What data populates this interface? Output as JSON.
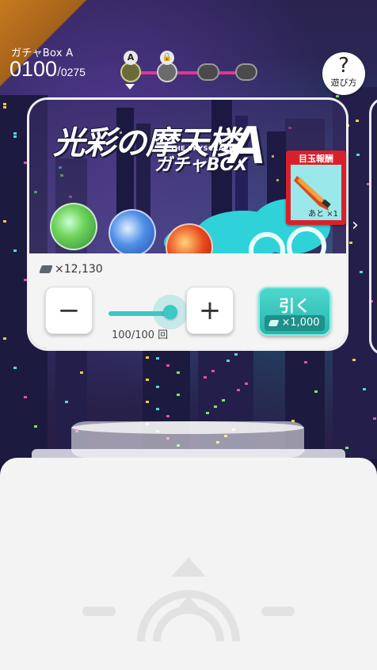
{
  "header": {
    "box_label": "ガチャBox A",
    "count_current": "0100",
    "count_separator": "/",
    "count_total": "0275"
  },
  "progress": {
    "nodes": [
      {
        "badge": "A",
        "state": "current"
      },
      {
        "badge": "lock",
        "state": "locked"
      },
      {
        "badge": "",
        "state": "empty"
      },
      {
        "badge": "",
        "state": "empty"
      }
    ]
  },
  "help": {
    "icon_text": "?",
    "label": "遊び方"
  },
  "gacha": {
    "title_jp": "光彩の摩天楼",
    "title_en": "THE SKYSCRAPER",
    "title_box": "ガチャBOX",
    "title_letter": "A",
    "coin_balance": "×12,130",
    "draw_count": "100/100 回",
    "minus_label": "−",
    "plus_label": "+",
    "pull_label": "引く",
    "pull_cost": "×1,000",
    "slider_fraction": 1.0
  },
  "reward": {
    "title": "目玉報酬",
    "remaining": "あと ×1"
  },
  "colors": {
    "accent_teal": "#3cc8c4",
    "reward_red": "#d8202a",
    "corner_orange": "#c77a1e",
    "progress_pink": "#e0388d"
  }
}
